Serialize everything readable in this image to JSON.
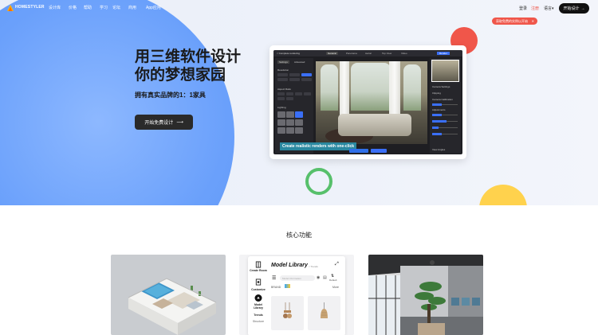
{
  "brand": {
    "name": "HOMESTYLER"
  },
  "nav": {
    "items": [
      "设计库",
      "价格",
      "帮助",
      "学习",
      "论坛",
      "商用",
      "App应用"
    ],
    "login": "登录",
    "register": "注册",
    "language": "语言",
    "start_design": "开始设计"
  },
  "notice": {
    "text": "获取免费的实例以开始",
    "close": "✕"
  },
  "hero": {
    "title_line1": "用三维软件设计",
    "title_line2": "你的梦想家园",
    "subtitle": "拥有真实品牌的1：1家具",
    "cta": "开始免费设计"
  },
  "mockup": {
    "app_title": "< Complete rendering",
    "tabs": [
      "General",
      "Panorama",
      "Aerial",
      "Top View",
      "Video"
    ],
    "left_labels": [
      "Settings",
      "Advanced",
      "Resolution",
      "Aspect Ratio",
      "Lighting"
    ],
    "right_labels": [
      "Camera Settings",
      "Clipping",
      "Camera Calibration",
      "Adjustments",
      "View Angles"
    ],
    "banner": "Create realistic renders with one-click",
    "render_button": "Render"
  },
  "features": {
    "section_title": "核心功能",
    "library": {
      "title": "Model Library",
      "trends_tag": "< Trends",
      "side_items": [
        "Create Room",
        "Customize",
        "Model Library",
        "Trends",
        "Structure"
      ],
      "search_placeholder": "Model information",
      "brand_filter": "BRAND",
      "more": "More",
      "default_sort": "Default"
    }
  },
  "colors": {
    "accent_blue": "#5d95f5",
    "accent_red": "#f0564a",
    "accent_green": "#57c06b",
    "accent_yellow": "#ffd24d",
    "cta_dark": "#2a2a2a"
  }
}
